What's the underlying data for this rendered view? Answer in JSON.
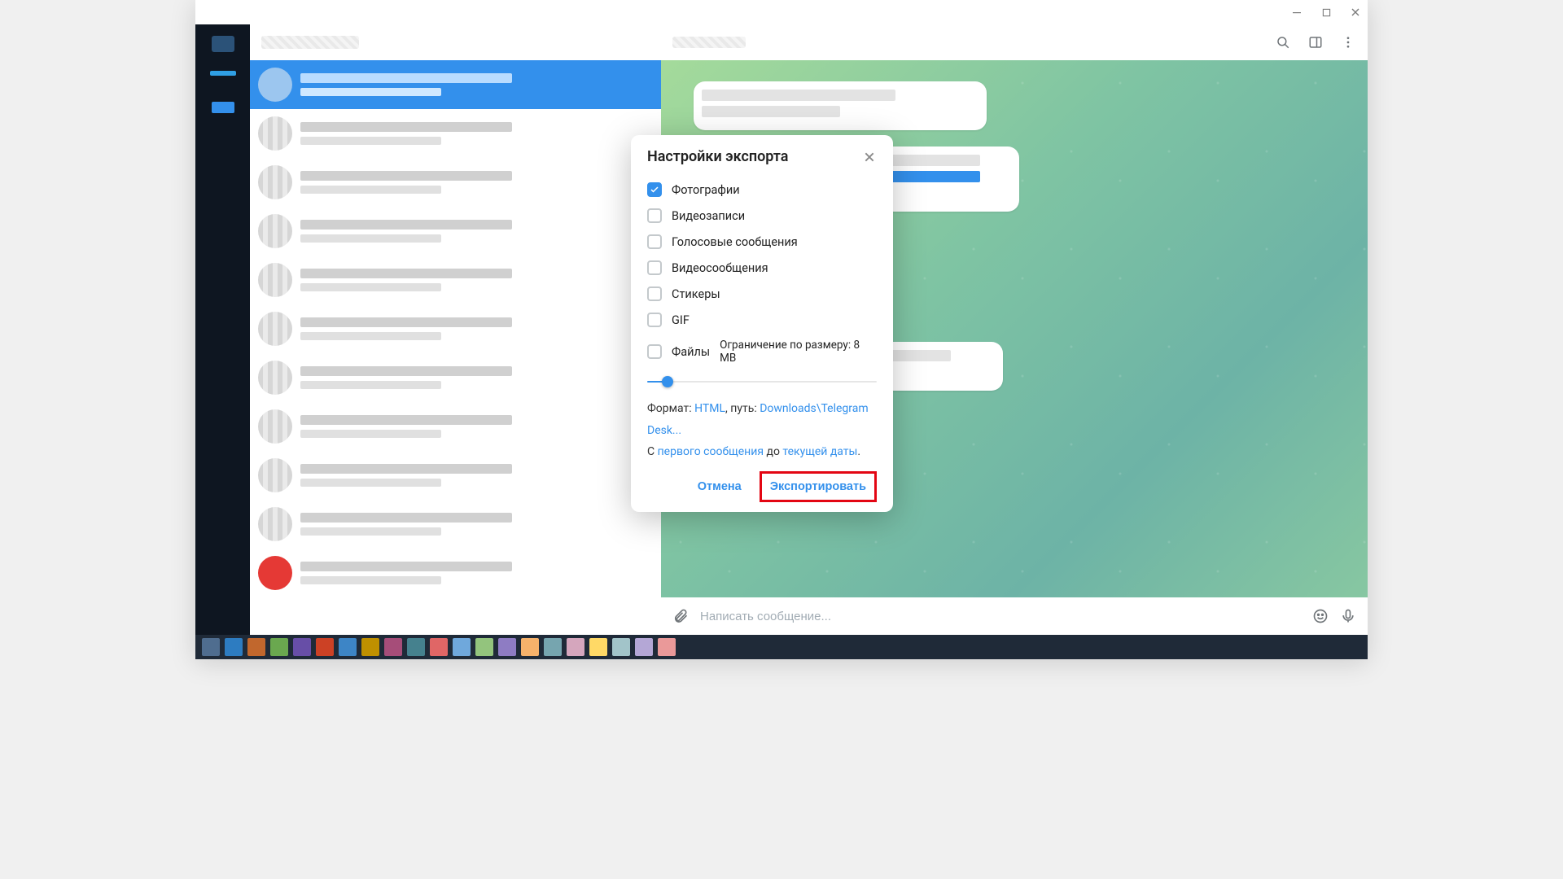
{
  "dialog": {
    "title": "Настройки экспорта",
    "options": {
      "photos": {
        "label": "Фотографии",
        "checked": true
      },
      "videos": {
        "label": "Видеозаписи",
        "checked": false
      },
      "voice": {
        "label": "Голосовые сообщения",
        "checked": false
      },
      "vmsg": {
        "label": "Видеосообщения",
        "checked": false
      },
      "stickers": {
        "label": "Стикеры",
        "checked": false
      },
      "gif": {
        "label": "GIF",
        "checked": false
      },
      "files": {
        "label": "Файлы",
        "checked": false
      }
    },
    "size_limit": {
      "prefix": "Ограничение по размеру:",
      "value": "8 MB",
      "slider_percent": 9
    },
    "format_line": {
      "format_prefix": "Формат: ",
      "format_value": "HTML",
      "path_prefix": ", путь: ",
      "path_value": "Downloads\\Telegram Desk..."
    },
    "range_line": {
      "from_prefix": "С ",
      "from_value": "первого сообщения",
      "to_prefix": " до ",
      "to_value": "текущей даты",
      "suffix": "."
    },
    "cancel_label": "Отмена",
    "export_label": "Экспортировать"
  },
  "composer": {
    "placeholder": "Написать сообщение..."
  }
}
